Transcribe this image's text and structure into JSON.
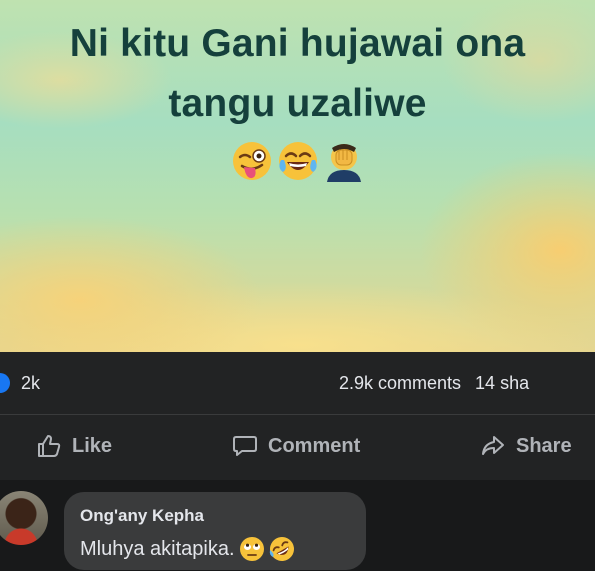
{
  "post": {
    "headline_line1": "Ni kitu Gani hujawai ona",
    "headline_line2": "tangu uzaliwe",
    "emojis": [
      "winking-face-with-tongue",
      "face-with-tears-of-joy",
      "face-palm"
    ]
  },
  "stats": {
    "reactions_count": "2k",
    "comments": "2.9k comments",
    "shares": "14 sha"
  },
  "actions": {
    "like": "Like",
    "comment": "Comment",
    "share": "Share"
  },
  "comment": {
    "author": "Ong'any Kepha",
    "text": "Mluhya akitapika.",
    "emojis": [
      "face-with-rolling-eyes",
      "rolling-on-the-floor-laughing"
    ]
  },
  "colors": {
    "background": "#18191a",
    "panel": "#222324",
    "bubble": "#3a3b3c",
    "headline": "#15403c",
    "like_blue": "#1877f2"
  }
}
